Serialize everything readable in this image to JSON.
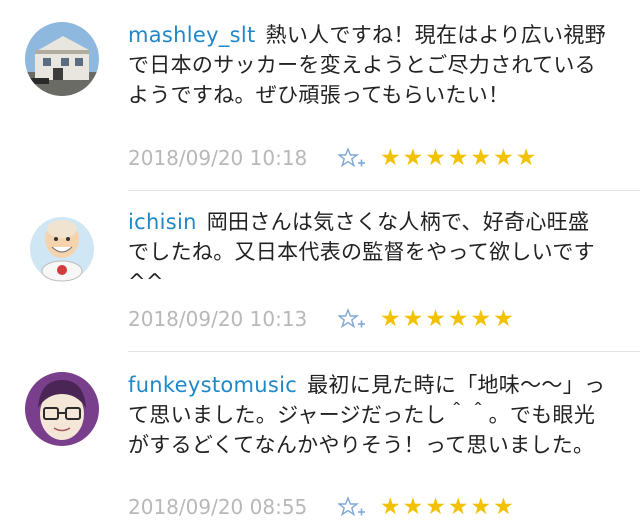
{
  "comments": [
    {
      "username": "mashley_slt",
      "text": "熱い人ですね！現在はより広い視野で日本のサッカーを変えようとご尽力されているようですね。ぜひ頑張ってもらいたい！",
      "timestamp": "2018/09/20 10:18",
      "star_string": "★★★★★★★",
      "avatar": "house-photo-avatar"
    },
    {
      "username": "ichisin",
      "text": "岡田さんは気さくな人柄で、好奇心旺盛でしたね。又日本代表の監督をやって欲しいです^^",
      "timestamp": "2018/09/20 10:13",
      "star_string": "★★★★★★",
      "avatar": "cartoon-old-man-avatar"
    },
    {
      "username": "funkeystomusic",
      "text": "最初に見た時に「地味〜〜」って思いました。ジャージだったし＾＾。でも眼光がするどくてなんかやりそう！って思いました。",
      "timestamp": "2018/09/20 08:55",
      "star_string": "★★★★★★",
      "avatar": "glasses-face-avatar"
    }
  ],
  "icons": {
    "add_star": "star-plus-icon"
  },
  "colors": {
    "username": "#1f88c8",
    "timestamp": "#b8b8b8",
    "stars": "#f2c200",
    "add_star_icon": "#7fa8d6"
  }
}
